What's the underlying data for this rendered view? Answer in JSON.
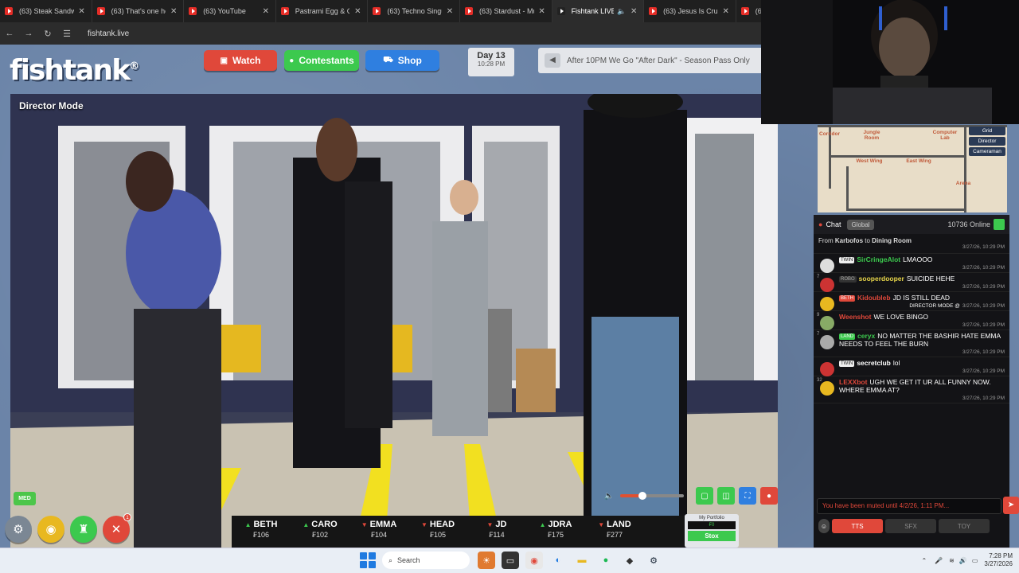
{
  "browser": {
    "tabs": [
      {
        "title": "(63) Steak Sandwic",
        "active": false
      },
      {
        "title": "(63) That's one he",
        "active": false
      },
      {
        "title": "(63) YouTube",
        "active": false
      },
      {
        "title": "Pastrami Egg & Ch",
        "active": false
      },
      {
        "title": "(63) Techno Singul",
        "active": false
      },
      {
        "title": "(63) Stardust - Mu",
        "active": false
      },
      {
        "title": "Fishtank LIVE",
        "active": true
      },
      {
        "title": "(63) Jesus Is Crucif",
        "active": false
      },
      {
        "title": "(6",
        "active": false
      }
    ],
    "url": "fishtank.live"
  },
  "site": {
    "logo": "fishtank",
    "logo_mark": "®",
    "nav": {
      "watch": "Watch",
      "contestants": "Contestants",
      "shop": "Shop"
    },
    "day": "Day 13",
    "day_time": "10:28 PM",
    "banner": "After 10PM We Go \"After Dark\" - Season Pass Only"
  },
  "video": {
    "mode_label": "Director Mode",
    "quality": "MED",
    "volume_level": 0.35
  },
  "ticker": [
    {
      "name": "BETH",
      "dir": "up",
      "price": "₣106"
    },
    {
      "name": "CARO",
      "dir": "up",
      "price": "₣102"
    },
    {
      "name": "EMMA",
      "dir": "down",
      "price": "₣104"
    },
    {
      "name": "HEAD",
      "dir": "down",
      "price": "₣105"
    },
    {
      "name": "JD",
      "dir": "down",
      "price": "₣114"
    },
    {
      "name": "JDRA",
      "dir": "up",
      "price": "₣175"
    },
    {
      "name": "LAND",
      "dir": "down",
      "price": "₣277"
    }
  ],
  "portfolio": {
    "label": "My Portfolio",
    "value": "₣0",
    "button": "Stox"
  },
  "map": {
    "rooms": [
      "Corridor",
      "Jungle Room",
      "Computer Lab",
      "West Wing",
      "East Wing",
      "Arena"
    ],
    "modes": [
      "Grid",
      "Director",
      "Cameraman"
    ]
  },
  "chat": {
    "title": "Chat",
    "scope": "Global",
    "online": "10736 Online",
    "system": {
      "from": "From",
      "user": "Karbofos",
      "to": "to",
      "target": "Dining Room",
      "ts": "3/27/26, 10:29 PM"
    },
    "messages": [
      {
        "level": "",
        "tag": "TWIN",
        "tag_style": "w",
        "user": "SirCringeAlot",
        "color": "#3cc94e",
        "text": "LMAOOO",
        "ts": "3/27/26, 10:29 PM",
        "extra": "",
        "avatar": "#ddd"
      },
      {
        "level": "7",
        "tag": "ROBO",
        "tag_style": "d",
        "user": "sooperdooper",
        "color": "#e8d64a",
        "text": "SUICIDE HEHE",
        "ts": "3/27/26, 10:29 PM",
        "extra": "",
        "avatar": "#c33"
      },
      {
        "level": "",
        "tag": "BETH",
        "tag_style": "r",
        "user": "Kidoubleb",
        "color": "#e0483a",
        "text": "JD IS STILL DEAD",
        "ts": "3/27/26, 10:29 PM",
        "extra": "DIRECTOR MODE @",
        "avatar": "#e8b820"
      },
      {
        "level": "9",
        "tag": "",
        "tag_style": "",
        "user": "Weenshot",
        "color": "#e0483a",
        "text": "WE LOVE BINGO",
        "ts": "3/27/26, 10:29 PM",
        "extra": "",
        "avatar": "#8a6"
      },
      {
        "level": "7",
        "tag": "LAND",
        "tag_style": "g",
        "user": "ceryx",
        "color": "#3cc94e",
        "text": "NO MATTER THE BASHIR HATE EMMA NEEDS TO FEEL THE BURN",
        "ts": "3/27/26, 10:29 PM",
        "extra": "",
        "avatar": "#aaa"
      },
      {
        "level": "",
        "tag": "TWIN",
        "tag_style": "w",
        "user": "secretclub",
        "color": "#ffffff",
        "text": "lol",
        "ts": "3/27/26, 10:29 PM",
        "extra": "",
        "avatar": "#c33"
      },
      {
        "level": "32",
        "tag": "",
        "tag_style": "",
        "user": "LEXXbot",
        "color": "#e0483a",
        "text": "UGH WE GET IT UR ALL FUNNY NOW. WHERE EMMA AT?",
        "ts": "3/27/26, 10:29 PM",
        "extra": "",
        "avatar": "#e8b820"
      }
    ],
    "input_placeholder": "You have been muted until 4/2/26, 1:11 PM...",
    "buttons": {
      "tts": "TTS",
      "sfx": "SFX",
      "toy": "TOY"
    }
  },
  "taskbar": {
    "search": "Search",
    "time": "7:28 PM",
    "date": "3/27/2026"
  }
}
